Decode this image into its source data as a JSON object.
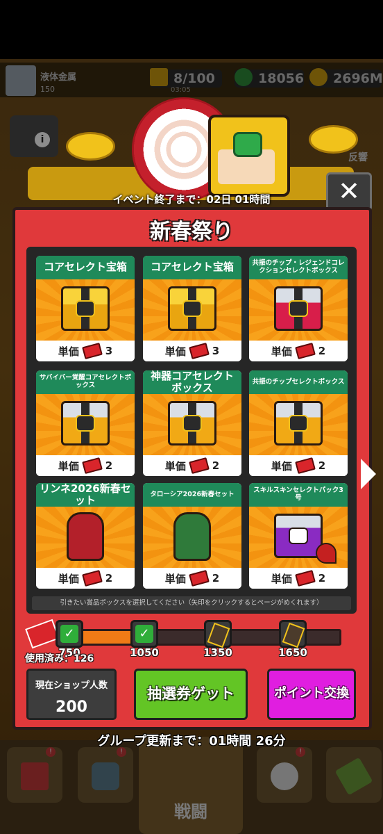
{
  "hud": {
    "player_name": "液体金属",
    "player_level": "150",
    "energy": "8/100",
    "energy_timer": "03:05",
    "gems": "18056",
    "gold": "2696M",
    "side_right_label": "反響"
  },
  "event": {
    "countdown": "イベント終了まで：02日 01時間",
    "title": "新春祭り",
    "close_label": "✕"
  },
  "unit_price_label": "単価",
  "cards": [
    {
      "title": "コアセレクト宝箱",
      "price": "3",
      "kind": "chest-gold"
    },
    {
      "title": "コアセレクト宝箱",
      "price": "3",
      "kind": "chest-gold"
    },
    {
      "title": "共振のチップ・レジェンドコレクションセレクトボックス",
      "price": "2",
      "kind": "chest-red"
    },
    {
      "title": "サバイバー覚醒コアセレクトボックス",
      "price": "2",
      "kind": "chest-goldsilver"
    },
    {
      "title": "神器コアセレクトボックス",
      "price": "2",
      "kind": "chest-goldsilver"
    },
    {
      "title": "共振のチップセレクトボックス",
      "price": "2",
      "kind": "chest-goldsilver"
    },
    {
      "title": "リンネ2026新春セット",
      "price": "2",
      "kind": "hero-red"
    },
    {
      "title": "タローシア2026新春セット",
      "price": "2",
      "kind": "hero-green"
    },
    {
      "title": "スキルスキンセレクトパック3号",
      "price": "2",
      "kind": "chest-purple"
    }
  ],
  "hint": "引きたい賞品ボックスを選択してください（矢印をクリックするとページがめくれます）",
  "progress": {
    "used_label": "使用済み：126",
    "fill": 0.28,
    "milestones": [
      "750",
      "1050",
      "1350",
      "1650"
    ]
  },
  "shop": {
    "label": "現在ショップ人数",
    "value": "200"
  },
  "buttons": {
    "draw": "抽選券ゲット",
    "exchange": "ポイント交換"
  },
  "group_refresh": "グループ更新まで：01時間 26分",
  "nav": {
    "battle": "戦闘"
  },
  "colors": {
    "panel": "#e0393b",
    "card_header": "#1f8a5a",
    "draw_button": "#63c525",
    "exchange_button": "#e01ee0",
    "progress": "#f07a16"
  }
}
